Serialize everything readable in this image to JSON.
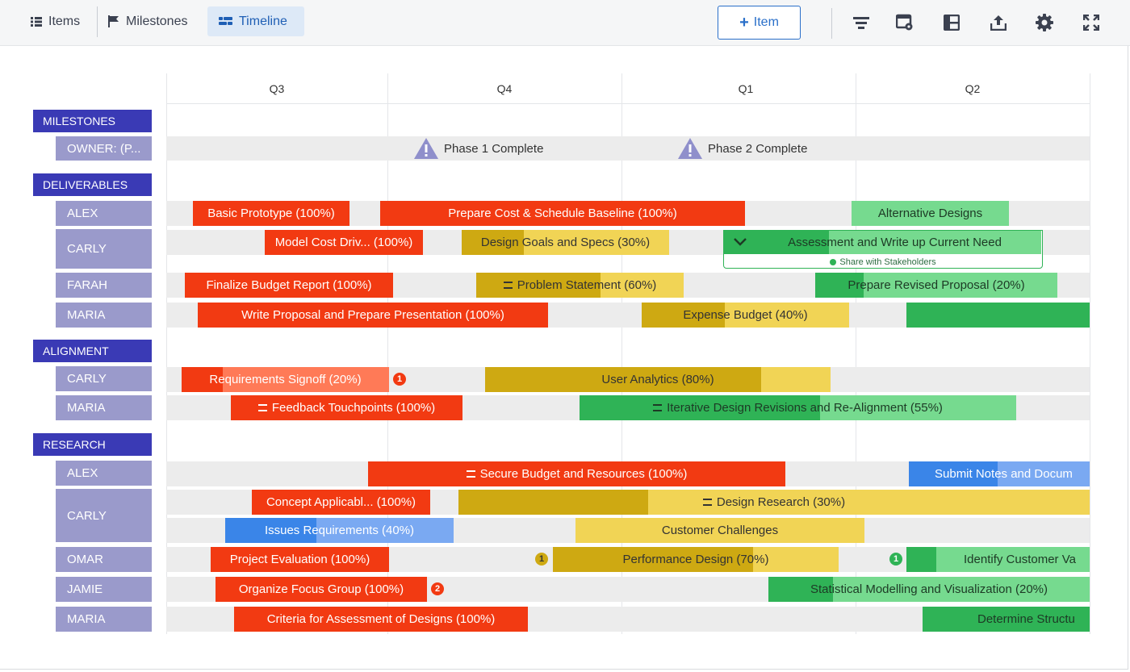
{
  "toolbar": {
    "tabs": [
      {
        "label": "Items",
        "icon": "list-icon"
      },
      {
        "label": "Milestones",
        "icon": "flag-icon"
      },
      {
        "label": "Timeline",
        "icon": "timeline-icon"
      }
    ],
    "add_label": "Item",
    "icons": [
      "filter-icon",
      "card-settings-icon",
      "layout-icon",
      "export-icon",
      "gear-icon",
      "fullscreen-icon"
    ]
  },
  "quarters": [
    "Q3",
    "Q4",
    "Q1",
    "Q2"
  ],
  "groups": {
    "milestones": "MILESTONES",
    "deliverables": "DELIVERABLES",
    "alignment": "ALIGNMENT",
    "research": "RESEARCH"
  },
  "owners": {
    "milestone_owner": "OWNER: (P...",
    "alex": "ALEX",
    "carly": "CARLY",
    "farah": "FARAH",
    "maria": "MARIA",
    "omar": "OMAR",
    "jamie": "JAMIE"
  },
  "milestones": [
    "Phase 1 Complete",
    "Phase 2 Complete"
  ],
  "items": {
    "basic_prototype": "Basic Prototype (100%)",
    "prepare_cost": "Prepare Cost & Schedule Baseline (100%)",
    "alternative_designs": "Alternative Designs",
    "model_cost": "Model Cost Driv... (100%)",
    "design_goals": "Design Goals and Specs (30%)",
    "assessment": "Assessment and Write up Current Need",
    "share_stakeholders": "Share with Stakeholders",
    "finalize_budget": "Finalize Budget Report (100%)",
    "problem_statement": "Problem Statement (60%)",
    "prepare_revised": "Prepare Revised Proposal (20%)",
    "write_proposal": "Write Proposal and Prepare Presentation (100%)",
    "expense_budget": "Expense Budget (40%)",
    "requirements_signoff": "Requirements Signoff (20%)",
    "user_analytics": "User Analytics (80%)",
    "feedback_touchpoints": "Feedback Touchpoints (100%)",
    "iterative_design": "Iterative Design Revisions and Re-Alignment (55%)",
    "secure_budget": "Secure Budget and Resources (100%)",
    "submit_notes": "Submit Notes and Docum",
    "concept_applicable": "Concept Applicabl... (100%)",
    "design_research": "Design Research (30%)",
    "issues_requirements": "Issues Requirements (40%)",
    "customer_challenges": "Customer Challenges",
    "project_evaluation": "Project Evaluation (100%)",
    "performance_design": "Performance Design (70%)",
    "identify_customer": "Identify Customer Va",
    "organize_focus": "Organize Focus Group (100%)",
    "statistical_modelling": "Statistical Modelling and Visualization (20%)",
    "criteria_assessment": "Criteria for Assessment of Designs (100%)",
    "determine_structure": "Determine Structu"
  },
  "badges": {
    "signoff": "1",
    "performance": "1",
    "identify": "1",
    "organize": "2"
  },
  "progress": {
    "design_goals": 0.3,
    "problem_statement": 0.6,
    "prepare_revised": 0.2,
    "expense_budget": 0.4,
    "requirements_signoff": 0.2,
    "user_analytics": 0.8,
    "iterative_design": 0.55,
    "design_research": 0.3,
    "issues_requirements": 0.4,
    "performance_design": 0.7,
    "statistical_modelling": 0.2
  },
  "colors": {
    "accent": "#2a6fc9",
    "group": "#3a3ab5",
    "owner": "#9a9acb",
    "complete": "#f23a12",
    "in_progress_yellow": "#cea912",
    "in_progress_green": "#2fb356",
    "in_progress_blue": "#3a85e8"
  }
}
